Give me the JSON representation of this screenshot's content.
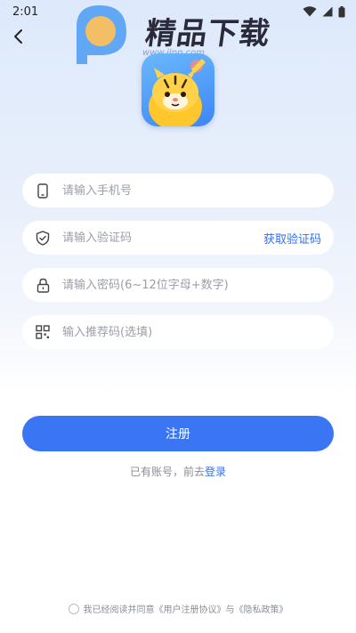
{
  "status_bar": {
    "time": "2:01"
  },
  "watermark": {
    "brand": "精品下载",
    "url": "www.jlpp.com"
  },
  "form": {
    "phone_placeholder": "请输入手机号",
    "code_placeholder": "请输入验证码",
    "get_code_label": "获取验证码",
    "password_placeholder": "请输入密码(6~12位字母+数字)",
    "referral_placeholder": "输入推荐码(选填)"
  },
  "actions": {
    "register_label": "注册",
    "login_prompt": "已有账号，前去",
    "login_link": "登录"
  },
  "agreement": {
    "prefix": "我已经阅读并同意",
    "user_agreement": "《用户注册协议》",
    "conjunction": "与",
    "privacy_policy": "《隐私政策》"
  },
  "colors": {
    "accent": "#3a76f4",
    "link": "#2f6ff0",
    "placeholder": "#9a9ea6"
  },
  "icons": {
    "back": "chevron-left-icon",
    "phone": "phone-icon",
    "code": "shield-check-icon",
    "password": "lock-icon",
    "referral": "qr-code-icon"
  }
}
